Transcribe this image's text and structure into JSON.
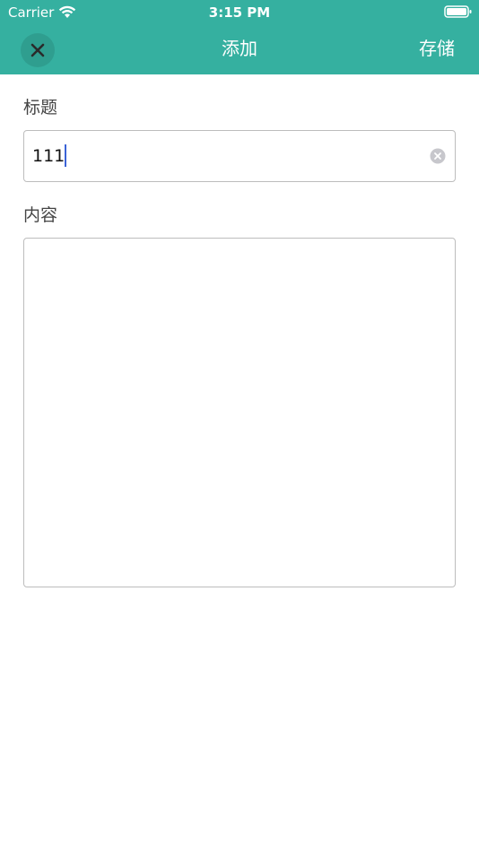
{
  "status_bar": {
    "carrier": "Carrier",
    "time": "3:15 PM",
    "wifi_icon": "wifi-icon",
    "battery_icon": "battery-icon"
  },
  "nav": {
    "title": "添加",
    "save_label": "存储",
    "close_icon": "close-icon",
    "background_color": "#35b0a0"
  },
  "form": {
    "title_label": "标题",
    "title_value": "111",
    "clear_icon": "clear-icon",
    "content_label": "内容",
    "content_value": ""
  }
}
